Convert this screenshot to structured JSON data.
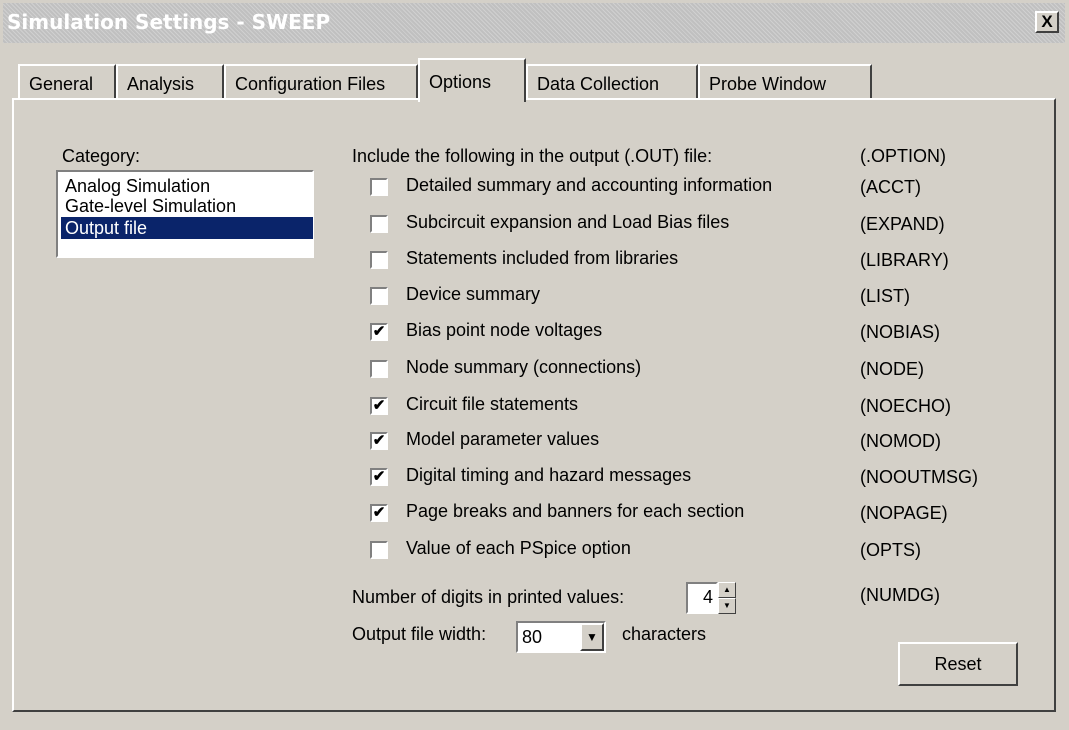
{
  "window": {
    "title": "Simulation Settings - SWEEP",
    "close_label": "X"
  },
  "tabs": [
    {
      "label": "General"
    },
    {
      "label": "Analysis"
    },
    {
      "label": "Configuration Files"
    },
    {
      "label": "Options",
      "active": true
    },
    {
      "label": "Data Collection"
    },
    {
      "label": "Probe Window"
    }
  ],
  "category": {
    "label": "Category:",
    "items": [
      "Analog Simulation",
      "Gate-level Simulation",
      "Output file"
    ],
    "selected": "Output file"
  },
  "output": {
    "heading": "Include the following in the output (.OUT) file:",
    "heading_code": "(.OPTION)",
    "options": [
      {
        "label": "Detailed summary and accounting information",
        "code": "(ACCT)",
        "checked": false
      },
      {
        "label": "Subcircuit expansion and Load Bias files",
        "code": "(EXPAND)",
        "checked": false
      },
      {
        "label": "Statements included from libraries",
        "code": "(LIBRARY)",
        "checked": false
      },
      {
        "label": "Device summary",
        "code": "(LIST)",
        "checked": false
      },
      {
        "label": "Bias point node voltages",
        "code": "(NOBIAS)",
        "checked": true
      },
      {
        "label": "Node summary (connections)",
        "code": "(NODE)",
        "checked": false
      },
      {
        "label": "Circuit file statements",
        "code": "(NOECHO)",
        "checked": true
      },
      {
        "label": "Model parameter values",
        "code": "(NOMOD)",
        "checked": true
      },
      {
        "label": "Digital timing and hazard messages",
        "code": "(NOOUTMSG)",
        "checked": true
      },
      {
        "label": "Page breaks and banners for each section",
        "code": "(NOPAGE)",
        "checked": true
      },
      {
        "label": "Value of each PSpice option",
        "code": "(OPTS)",
        "checked": false
      }
    ],
    "digits": {
      "label": "Number of digits in printed values:",
      "value": "4",
      "code": "(NUMDG)"
    },
    "width": {
      "label": "Output file width:",
      "value": "80",
      "suffix": "characters"
    },
    "reset_label": "Reset"
  }
}
